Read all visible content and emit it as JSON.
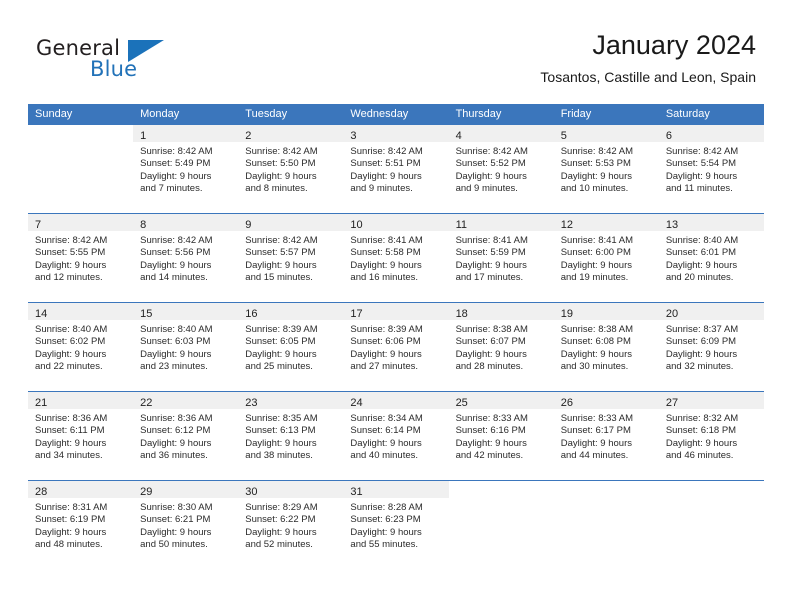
{
  "brand": {
    "name_dark": "General",
    "name_blue": "Blue",
    "accent_color": "#1b72ba"
  },
  "header": {
    "title": "January 2024",
    "subtitle": "Tosantos, Castille and Leon, Spain",
    "header_bg_color": "#3b76bc",
    "daynum_band_color": "#f0f0f0"
  },
  "weekdays": [
    "Sunday",
    "Monday",
    "Tuesday",
    "Wednesday",
    "Thursday",
    "Friday",
    "Saturday"
  ],
  "weeks": [
    [
      {
        "day": "",
        "sunrise": "",
        "sunset": "",
        "daylight1": "",
        "daylight2": ""
      },
      {
        "day": "1",
        "sunrise": "Sunrise: 8:42 AM",
        "sunset": "Sunset: 5:49 PM",
        "daylight1": "Daylight: 9 hours",
        "daylight2": "and 7 minutes."
      },
      {
        "day": "2",
        "sunrise": "Sunrise: 8:42 AM",
        "sunset": "Sunset: 5:50 PM",
        "daylight1": "Daylight: 9 hours",
        "daylight2": "and 8 minutes."
      },
      {
        "day": "3",
        "sunrise": "Sunrise: 8:42 AM",
        "sunset": "Sunset: 5:51 PM",
        "daylight1": "Daylight: 9 hours",
        "daylight2": "and 9 minutes."
      },
      {
        "day": "4",
        "sunrise": "Sunrise: 8:42 AM",
        "sunset": "Sunset: 5:52 PM",
        "daylight1": "Daylight: 9 hours",
        "daylight2": "and 9 minutes."
      },
      {
        "day": "5",
        "sunrise": "Sunrise: 8:42 AM",
        "sunset": "Sunset: 5:53 PM",
        "daylight1": "Daylight: 9 hours",
        "daylight2": "and 10 minutes."
      },
      {
        "day": "6",
        "sunrise": "Sunrise: 8:42 AM",
        "sunset": "Sunset: 5:54 PM",
        "daylight1": "Daylight: 9 hours",
        "daylight2": "and 11 minutes."
      }
    ],
    [
      {
        "day": "7",
        "sunrise": "Sunrise: 8:42 AM",
        "sunset": "Sunset: 5:55 PM",
        "daylight1": "Daylight: 9 hours",
        "daylight2": "and 12 minutes."
      },
      {
        "day": "8",
        "sunrise": "Sunrise: 8:42 AM",
        "sunset": "Sunset: 5:56 PM",
        "daylight1": "Daylight: 9 hours",
        "daylight2": "and 14 minutes."
      },
      {
        "day": "9",
        "sunrise": "Sunrise: 8:42 AM",
        "sunset": "Sunset: 5:57 PM",
        "daylight1": "Daylight: 9 hours",
        "daylight2": "and 15 minutes."
      },
      {
        "day": "10",
        "sunrise": "Sunrise: 8:41 AM",
        "sunset": "Sunset: 5:58 PM",
        "daylight1": "Daylight: 9 hours",
        "daylight2": "and 16 minutes."
      },
      {
        "day": "11",
        "sunrise": "Sunrise: 8:41 AM",
        "sunset": "Sunset: 5:59 PM",
        "daylight1": "Daylight: 9 hours",
        "daylight2": "and 17 minutes."
      },
      {
        "day": "12",
        "sunrise": "Sunrise: 8:41 AM",
        "sunset": "Sunset: 6:00 PM",
        "daylight1": "Daylight: 9 hours",
        "daylight2": "and 19 minutes."
      },
      {
        "day": "13",
        "sunrise": "Sunrise: 8:40 AM",
        "sunset": "Sunset: 6:01 PM",
        "daylight1": "Daylight: 9 hours",
        "daylight2": "and 20 minutes."
      }
    ],
    [
      {
        "day": "14",
        "sunrise": "Sunrise: 8:40 AM",
        "sunset": "Sunset: 6:02 PM",
        "daylight1": "Daylight: 9 hours",
        "daylight2": "and 22 minutes."
      },
      {
        "day": "15",
        "sunrise": "Sunrise: 8:40 AM",
        "sunset": "Sunset: 6:03 PM",
        "daylight1": "Daylight: 9 hours",
        "daylight2": "and 23 minutes."
      },
      {
        "day": "16",
        "sunrise": "Sunrise: 8:39 AM",
        "sunset": "Sunset: 6:05 PM",
        "daylight1": "Daylight: 9 hours",
        "daylight2": "and 25 minutes."
      },
      {
        "day": "17",
        "sunrise": "Sunrise: 8:39 AM",
        "sunset": "Sunset: 6:06 PM",
        "daylight1": "Daylight: 9 hours",
        "daylight2": "and 27 minutes."
      },
      {
        "day": "18",
        "sunrise": "Sunrise: 8:38 AM",
        "sunset": "Sunset: 6:07 PM",
        "daylight1": "Daylight: 9 hours",
        "daylight2": "and 28 minutes."
      },
      {
        "day": "19",
        "sunrise": "Sunrise: 8:38 AM",
        "sunset": "Sunset: 6:08 PM",
        "daylight1": "Daylight: 9 hours",
        "daylight2": "and 30 minutes."
      },
      {
        "day": "20",
        "sunrise": "Sunrise: 8:37 AM",
        "sunset": "Sunset: 6:09 PM",
        "daylight1": "Daylight: 9 hours",
        "daylight2": "and 32 minutes."
      }
    ],
    [
      {
        "day": "21",
        "sunrise": "Sunrise: 8:36 AM",
        "sunset": "Sunset: 6:11 PM",
        "daylight1": "Daylight: 9 hours",
        "daylight2": "and 34 minutes."
      },
      {
        "day": "22",
        "sunrise": "Sunrise: 8:36 AM",
        "sunset": "Sunset: 6:12 PM",
        "daylight1": "Daylight: 9 hours",
        "daylight2": "and 36 minutes."
      },
      {
        "day": "23",
        "sunrise": "Sunrise: 8:35 AM",
        "sunset": "Sunset: 6:13 PM",
        "daylight1": "Daylight: 9 hours",
        "daylight2": "and 38 minutes."
      },
      {
        "day": "24",
        "sunrise": "Sunrise: 8:34 AM",
        "sunset": "Sunset: 6:14 PM",
        "daylight1": "Daylight: 9 hours",
        "daylight2": "and 40 minutes."
      },
      {
        "day": "25",
        "sunrise": "Sunrise: 8:33 AM",
        "sunset": "Sunset: 6:16 PM",
        "daylight1": "Daylight: 9 hours",
        "daylight2": "and 42 minutes."
      },
      {
        "day": "26",
        "sunrise": "Sunrise: 8:33 AM",
        "sunset": "Sunset: 6:17 PM",
        "daylight1": "Daylight: 9 hours",
        "daylight2": "and 44 minutes."
      },
      {
        "day": "27",
        "sunrise": "Sunrise: 8:32 AM",
        "sunset": "Sunset: 6:18 PM",
        "daylight1": "Daylight: 9 hours",
        "daylight2": "and 46 minutes."
      }
    ],
    [
      {
        "day": "28",
        "sunrise": "Sunrise: 8:31 AM",
        "sunset": "Sunset: 6:19 PM",
        "daylight1": "Daylight: 9 hours",
        "daylight2": "and 48 minutes."
      },
      {
        "day": "29",
        "sunrise": "Sunrise: 8:30 AM",
        "sunset": "Sunset: 6:21 PM",
        "daylight1": "Daylight: 9 hours",
        "daylight2": "and 50 minutes."
      },
      {
        "day": "30",
        "sunrise": "Sunrise: 8:29 AM",
        "sunset": "Sunset: 6:22 PM",
        "daylight1": "Daylight: 9 hours",
        "daylight2": "and 52 minutes."
      },
      {
        "day": "31",
        "sunrise": "Sunrise: 8:28 AM",
        "sunset": "Sunset: 6:23 PM",
        "daylight1": "Daylight: 9 hours",
        "daylight2": "and 55 minutes."
      },
      {
        "day": "",
        "sunrise": "",
        "sunset": "",
        "daylight1": "",
        "daylight2": ""
      },
      {
        "day": "",
        "sunrise": "",
        "sunset": "",
        "daylight1": "",
        "daylight2": ""
      },
      {
        "day": "",
        "sunrise": "",
        "sunset": "",
        "daylight1": "",
        "daylight2": ""
      }
    ]
  ]
}
